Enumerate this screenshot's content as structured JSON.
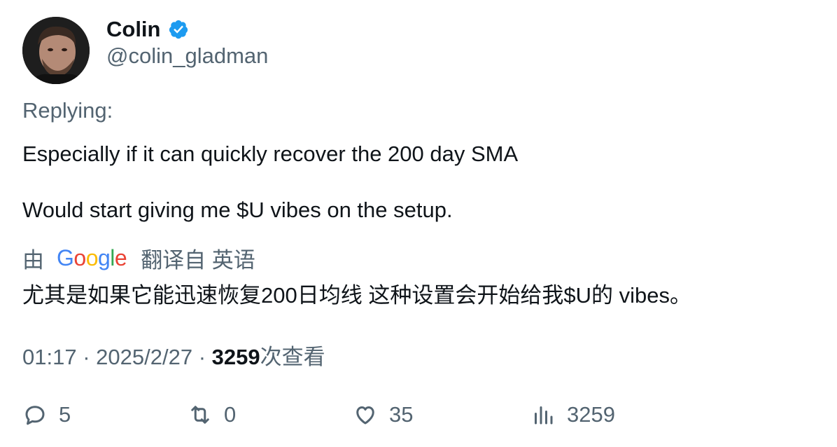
{
  "author": {
    "display_name": "Colin",
    "handle": "@colin_gladman"
  },
  "replying_label": "Replying:",
  "tweet": {
    "line1": "Especially if it can quickly recover the 200 day SMA",
    "line2": "Would start giving me $U vibes on the setup."
  },
  "translation": {
    "by_label": "由",
    "google_letters": [
      "G",
      "o",
      "o",
      "g",
      "l",
      "e"
    ],
    "translate_link": "翻译自 英语",
    "translated_text": "尤其是如果它能迅速恢复200日均线 这种设置会开始给我$U的 vibes。"
  },
  "meta": {
    "time": "01:17",
    "separator": "·",
    "date": "2025/2/27",
    "views_count": "3259",
    "views_label": "次查看"
  },
  "actions": {
    "replies": "5",
    "retweets": "0",
    "likes": "35",
    "views": "3259"
  },
  "colors": {
    "verified": "#1d9bf0",
    "secondary_text": "#536471",
    "primary_text": "#0f1419"
  },
  "icons": {
    "avatar": "avatar",
    "verified": "verified-badge-icon",
    "reply": "reply-icon",
    "retweet": "retweet-icon",
    "like": "heart-icon",
    "views": "analytics-icon"
  }
}
